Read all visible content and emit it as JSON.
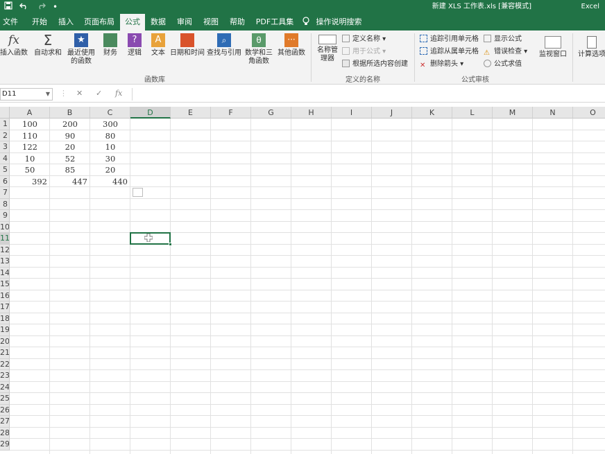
{
  "window": {
    "title": "新建 XLS 工作表.xls  [兼容模式]",
    "app": "Excel"
  },
  "qat": {
    "save_icon": "save-icon",
    "undo_icon": "undo-icon",
    "redo_icon": "redo-icon",
    "more": "•"
  },
  "tabs": [
    {
      "label": "文件"
    },
    {
      "label": "开始"
    },
    {
      "label": "插入"
    },
    {
      "label": "页面布局"
    },
    {
      "label": "公式"
    },
    {
      "label": "数据"
    },
    {
      "label": "审阅"
    },
    {
      "label": "视图"
    },
    {
      "label": "帮助"
    },
    {
      "label": "PDF工具集"
    }
  ],
  "active_tab": "公式",
  "tell_me": "操作说明搜索",
  "ribbon": {
    "function_library": {
      "insert_function": "插入函数",
      "autosum": "自动求和",
      "recent": "最近使用的函数",
      "financial": "财务",
      "logical": "逻辑",
      "text": "文本",
      "datetime": "日期和时间",
      "lookup": "查找与引用",
      "math": "数学和三角函数",
      "more": "其他函数",
      "group": "函数库"
    },
    "defined_names": {
      "name_manager": "名称管理器",
      "define_name": "定义名称",
      "use_in_formula": "用于公式",
      "create_from_selection": "根据所选内容创建",
      "group": "定义的名称"
    },
    "formula_auditing": {
      "trace_precedents": "追踪引用单元格",
      "trace_dependents": "追踪从属单元格",
      "remove_arrows": "删除箭头",
      "show_formulas": "显示公式",
      "error_checking": "错误检查",
      "evaluate_formula": "公式求值",
      "group": "公式审核"
    },
    "watch_window": "监视窗口",
    "calc_options": "计算选项"
  },
  "formula_bar": {
    "name_box": "D11",
    "fx": "fx",
    "cancel": "✕",
    "enter": "✓",
    "content": ""
  },
  "columns": [
    "A",
    "B",
    "C",
    "D",
    "E",
    "F",
    "G",
    "H",
    "I",
    "J",
    "K",
    "L",
    "M",
    "N",
    "O"
  ],
  "selected_column": "D",
  "selected_row": "11",
  "rows": [
    "1",
    "2",
    "3",
    "4",
    "5",
    "6",
    "7",
    "8",
    "9",
    "10",
    "11",
    "12",
    "13",
    "14",
    "15",
    "16",
    "17",
    "18",
    "19",
    "20",
    "21",
    "22",
    "23",
    "24",
    "25",
    "26",
    "27",
    "28",
    "29"
  ],
  "cells": [
    [
      "100",
      "200",
      "300"
    ],
    [
      "110",
      "90",
      "80"
    ],
    [
      "122",
      "20",
      "10"
    ],
    [
      "10",
      "52",
      "30"
    ],
    [
      "50",
      "85",
      "20"
    ],
    [
      "392",
      "447",
      "440"
    ]
  ]
}
